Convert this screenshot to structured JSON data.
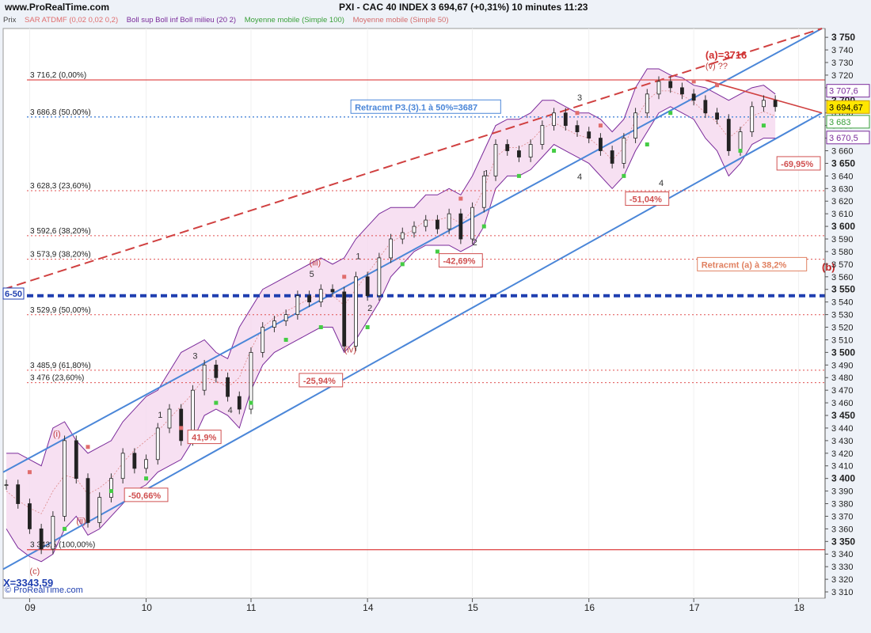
{
  "header": {
    "site": "www.ProRealTime.com",
    "title": "PXI - CAC 40 INDEX    3 694,67 (+0,31%)    10 minutes  11:23"
  },
  "legend": [
    {
      "label": "Prix",
      "color": "#444444"
    },
    {
      "label": "SAR ATDMF (0,02 0,02 0,2)",
      "color": "#e06d6d"
    },
    {
      "label": "Boll sup Boll inf Boll milieu (20 2)",
      "color": "#7a2a9a"
    },
    {
      "label": "Moyenne mobile (Simple 100)",
      "color": "#3aa03a"
    },
    {
      "label": "Moyenne mobile (Simple 50)",
      "color": "#d46a6a"
    }
  ],
  "footer": {
    "copyright": "© ProRealTime.com",
    "x_readout": "X=3343,59",
    "left_tag": "6-50"
  },
  "colors": {
    "up": "#3a8a3a",
    "down": "#d05050",
    "sar_up": "#44cc44",
    "sar_down": "#e06d6d",
    "boll": "#7a2a9a",
    "channel": "#4a86d8",
    "fib": "#e05050",
    "blue_line": "#1f3fb0"
  },
  "chart_data": {
    "type": "line",
    "x": [
      "09",
      "10",
      "11",
      "14",
      "15",
      "16",
      "17",
      "18"
    ],
    "ylim": [
      3305,
      3757
    ],
    "yticks": [
      3310,
      3320,
      3330,
      3340,
      3350,
      3360,
      3370,
      3380,
      3390,
      3400,
      3410,
      3420,
      3430,
      3440,
      3450,
      3460,
      3470,
      3480,
      3490,
      3500,
      3510,
      3520,
      3530,
      3540,
      3550,
      3560,
      3570,
      3580,
      3590,
      3600,
      3610,
      3620,
      3630,
      3640,
      3650,
      3660,
      3670,
      3680,
      3690,
      3700,
      3710,
      3720,
      3730,
      3740,
      3750
    ],
    "ytick_labels": [
      "3 310",
      "3 320",
      "3 330",
      "3 340",
      "3 350",
      "3 360",
      "3 370",
      "3 380",
      "3 390",
      "3 400",
      "3 410",
      "3 420",
      "3 430",
      "3 440",
      "3 450",
      "3 460",
      "3 470",
      "3 480",
      "3 490",
      "3 500",
      "3 510",
      "3 520",
      "3 530",
      "3 540",
      "3 550",
      "3 560",
      "3 570",
      "3 580",
      "3 590",
      "3 600",
      "3 610",
      "3 620",
      "3 630",
      "3 640",
      "3 650",
      "3 660",
      "3 670",
      "3 680",
      "3 690",
      "3 700",
      "3 710",
      "3 720",
      "3 730",
      "3 740",
      "3 750"
    ],
    "bold_ticks": [
      3350,
      3400,
      3450,
      3500,
      3550,
      3600,
      3650,
      3700,
      3750
    ],
    "series": [
      {
        "values": [
          3395,
          3380,
          3360,
          3344,
          3370,
          3430,
          3400,
          3365,
          3385,
          3400,
          3420,
          3408,
          3415,
          3440,
          3455,
          3430,
          3470,
          3490,
          3480,
          3465,
          3455,
          3500,
          3520,
          3525,
          3530,
          3545,
          3540,
          3550,
          3548,
          3505,
          3560,
          3545,
          3575,
          3590,
          3595,
          3600,
          3605,
          3598,
          3610,
          3590,
          3615,
          3640,
          3665,
          3660,
          3655,
          3665,
          3680,
          3690,
          3680,
          3675,
          3670,
          3660,
          3650,
          3670,
          3690,
          3705,
          3715,
          3710,
          3705,
          3700,
          3690,
          3685,
          3660,
          3675,
          3695,
          3700,
          3695
        ]
      }
    ],
    "bollinger_upper": [
      3420,
      3420,
      3415,
      3410,
      3440,
      3445,
      3430,
      3420,
      3425,
      3430,
      3445,
      3455,
      3465,
      3470,
      3485,
      3500,
      3505,
      3510,
      3500,
      3495,
      3520,
      3535,
      3550,
      3555,
      3560,
      3565,
      3570,
      3575,
      3570,
      3575,
      3590,
      3600,
      3610,
      3615,
      3615,
      3615,
      3625,
      3625,
      3630,
      3625,
      3640,
      3660,
      3680,
      3685,
      3685,
      3690,
      3700,
      3700,
      3695,
      3690,
      3690,
      3685,
      3675,
      3685,
      3710,
      3725,
      3725,
      3720,
      3718,
      3712,
      3710,
      3705,
      3700,
      3705,
      3710,
      3712,
      3705
    ],
    "bollinger_lower": [
      3360,
      3345,
      3338,
      3334,
      3340,
      3360,
      3370,
      3355,
      3360,
      3370,
      3380,
      3390,
      3395,
      3405,
      3410,
      3415,
      3430,
      3450,
      3455,
      3450,
      3440,
      3470,
      3490,
      3500,
      3505,
      3510,
      3515,
      3520,
      3520,
      3500,
      3510,
      3525,
      3540,
      3560,
      3570,
      3580,
      3585,
      3585,
      3585,
      3580,
      3585,
      3600,
      3630,
      3640,
      3640,
      3645,
      3655,
      3665,
      3660,
      3655,
      3650,
      3640,
      3630,
      3640,
      3660,
      3675,
      3690,
      3695,
      3690,
      3685,
      3670,
      3660,
      3640,
      3650,
      3665,
      3670,
      3670
    ],
    "sar_points": [
      {
        "i": 2,
        "v": 3405,
        "trend": "down"
      },
      {
        "i": 5,
        "v": 3360,
        "trend": "up"
      },
      {
        "i": 7,
        "v": 3425,
        "trend": "down"
      },
      {
        "i": 9,
        "v": 3390,
        "trend": "up"
      },
      {
        "i": 12,
        "v": 3400,
        "trend": "up"
      },
      {
        "i": 15,
        "v": 3440,
        "trend": "down"
      },
      {
        "i": 18,
        "v": 3460,
        "trend": "up"
      },
      {
        "i": 21,
        "v": 3460,
        "trend": "up"
      },
      {
        "i": 24,
        "v": 3510,
        "trend": "up"
      },
      {
        "i": 27,
        "v": 3520,
        "trend": "up"
      },
      {
        "i": 29,
        "v": 3560,
        "trend": "down"
      },
      {
        "i": 31,
        "v": 3520,
        "trend": "up"
      },
      {
        "i": 34,
        "v": 3570,
        "trend": "up"
      },
      {
        "i": 37,
        "v": 3580,
        "trend": "up"
      },
      {
        "i": 39,
        "v": 3622,
        "trend": "down"
      },
      {
        "i": 41,
        "v": 3600,
        "trend": "up"
      },
      {
        "i": 44,
        "v": 3640,
        "trend": "up"
      },
      {
        "i": 47,
        "v": 3660,
        "trend": "up"
      },
      {
        "i": 49,
        "v": 3690,
        "trend": "down"
      },
      {
        "i": 51,
        "v": 3680,
        "trend": "down"
      },
      {
        "i": 53,
        "v": 3640,
        "trend": "up"
      },
      {
        "i": 55,
        "v": 3665,
        "trend": "up"
      },
      {
        "i": 57,
        "v": 3690,
        "trend": "up"
      },
      {
        "i": 59,
        "v": 3715,
        "trend": "down"
      },
      {
        "i": 61,
        "v": 3712,
        "trend": "down"
      },
      {
        "i": 63,
        "v": 3660,
        "trend": "up"
      },
      {
        "i": 65,
        "v": 3680,
        "trend": "up"
      }
    ],
    "fib_levels": [
      {
        "value": 3716.2,
        "label": "3 716,2 (0,00%)",
        "style": "solid"
      },
      {
        "value": 3686.8,
        "label": "3 686,8 (50,00%)",
        "style": "blue-dotted"
      },
      {
        "value": 3628.3,
        "label": "3 628,3 (23,60%)",
        "style": "dotted"
      },
      {
        "value": 3592.6,
        "label": "3 592,6 (38,20%)",
        "style": "dotted"
      },
      {
        "value": 3573.9,
        "label": "3 573,9 (38,20%)",
        "style": "dotted"
      },
      {
        "value": 3529.9,
        "label": "3 529,9 (50,00%)",
        "style": "dotted"
      },
      {
        "value": 3485.9,
        "label": "3 485,9 (61,80%)",
        "style": "dotted"
      },
      {
        "value": 3476,
        "label": "3 476 (23,60%)",
        "style": "dotted"
      },
      {
        "value": 3343.5,
        "label": "3 343,5 (100,00%)",
        "style": "solid"
      }
    ],
    "annotations": [
      {
        "text": "(a)=3716",
        "i": 60,
        "v": 3733,
        "color": "#d03030",
        "bold": true
      },
      {
        "text": "(v) ??",
        "i": 60,
        "v": 3725,
        "color": "#c04040"
      },
      {
        "text": "(iii)",
        "i": 26,
        "v": 3569,
        "color": "#c04040"
      },
      {
        "text": "(iv)",
        "i": 29,
        "v": 3500,
        "color": "#c04040"
      },
      {
        "text": "(i)",
        "i": 4,
        "v": 3433,
        "color": "#c04040"
      },
      {
        "text": "(ii)",
        "i": 6,
        "v": 3364,
        "color": "#c04040"
      },
      {
        "text": "(c)",
        "i": 2,
        "v": 3324,
        "color": "#c04040"
      },
      {
        "text": "(b)",
        "i": 70,
        "v": 3565,
        "color": "#c02020",
        "bold": true
      },
      {
        "text": "3",
        "i": 16,
        "v": 3495,
        "color": "#333333"
      },
      {
        "text": "1",
        "i": 13,
        "v": 3448,
        "color": "#333333"
      },
      {
        "text": "2",
        "i": 13,
        "v": 3388,
        "color": "#333333"
      },
      {
        "text": "4",
        "i": 19,
        "v": 3452,
        "color": "#333333"
      },
      {
        "text": "5",
        "i": 26,
        "v": 3560,
        "color": "#333333"
      },
      {
        "text": "1",
        "i": 30,
        "v": 3574,
        "color": "#333333"
      },
      {
        "text": "2",
        "i": 31,
        "v": 3533,
        "color": "#333333"
      },
      {
        "text": "1",
        "i": 41,
        "v": 3640,
        "color": "#333333"
      },
      {
        "text": "2",
        "i": 40,
        "v": 3585,
        "color": "#333333"
      },
      {
        "text": "3",
        "i": 49,
        "v": 3700,
        "color": "#333333"
      },
      {
        "text": "4",
        "i": 49,
        "v": 3637,
        "color": "#333333"
      },
      {
        "text": "4",
        "i": 56,
        "v": 3632,
        "color": "#333333"
      }
    ],
    "boxes": [
      {
        "text": "Retracmt P3.(3).1 à 50%=3687",
        "i": 36,
        "v": 3695,
        "color": "#4a86d8",
        "fill": "#ffffff"
      },
      {
        "text": "Retracmt (a) à 38,2%",
        "i": 64,
        "v": 3570,
        "color": "#e08060",
        "fill": "#ffffff"
      },
      {
        "text": "-51,04%",
        "i": 55,
        "v": 3622,
        "color": "#d05050",
        "fill": "#ffffff"
      },
      {
        "text": "-69,95%",
        "i": 68,
        "v": 3650,
        "color": "#d05050",
        "fill": "#ffffff"
      },
      {
        "text": "-42,69%",
        "i": 39,
        "v": 3573,
        "color": "#d05050",
        "fill": "#ffffff"
      },
      {
        "text": "-25,94%",
        "i": 27,
        "v": 3478,
        "color": "#d05050",
        "fill": "#ffffff"
      },
      {
        "text": "41,9%",
        "i": 17,
        "v": 3433,
        "color": "#d05050",
        "fill": "#ffffff"
      },
      {
        "text": "-50,66%",
        "i": 12,
        "v": 3387,
        "color": "#d05050",
        "fill": "#ffffff"
      }
    ],
    "price_tags": [
      {
        "text": "3 707,6",
        "v": 3707.6,
        "bg": "#ffffff",
        "fg": "#7a2a9a",
        "border": "#7a2a9a"
      },
      {
        "text": "3 694,67",
        "v": 3694.67,
        "bg": "#ffe600",
        "fg": "#000000",
        "border": "#cca000"
      },
      {
        "text": "3 683",
        "v": 3683,
        "bg": "#ffffff",
        "fg": "#3aa03a",
        "border": "#3aa03a"
      },
      {
        "text": "3 670,5",
        "v": 3670.5,
        "bg": "#ffffff",
        "fg": "#7a2a9a",
        "border": "#7a2a9a"
      }
    ]
  }
}
